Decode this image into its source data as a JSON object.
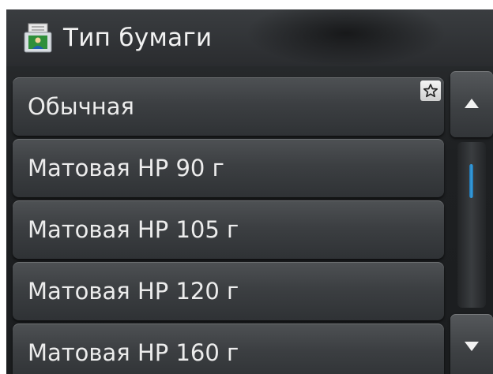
{
  "header": {
    "title": "Тип бумаги",
    "icon": "paper-type-icon"
  },
  "list": {
    "items": [
      {
        "label": "Обычная",
        "favorite": true
      },
      {
        "label": "Матовая HP 90 г",
        "favorite": false
      },
      {
        "label": "Матовая HP 105 г",
        "favorite": false
      },
      {
        "label": "Матовая HP 120 г",
        "favorite": false
      },
      {
        "label": "Матовая HP 160 г",
        "favorite": false
      }
    ]
  },
  "scrollbar": {
    "up_icon": "arrow-up-icon",
    "down_icon": "arrow-down-icon",
    "thumb_color": "#3aa0e0",
    "position_fraction": 0.0,
    "visible_fraction": 0.25
  },
  "colors": {
    "background": "#1e2022",
    "row": "#3c3f42",
    "text": "#ececec"
  }
}
